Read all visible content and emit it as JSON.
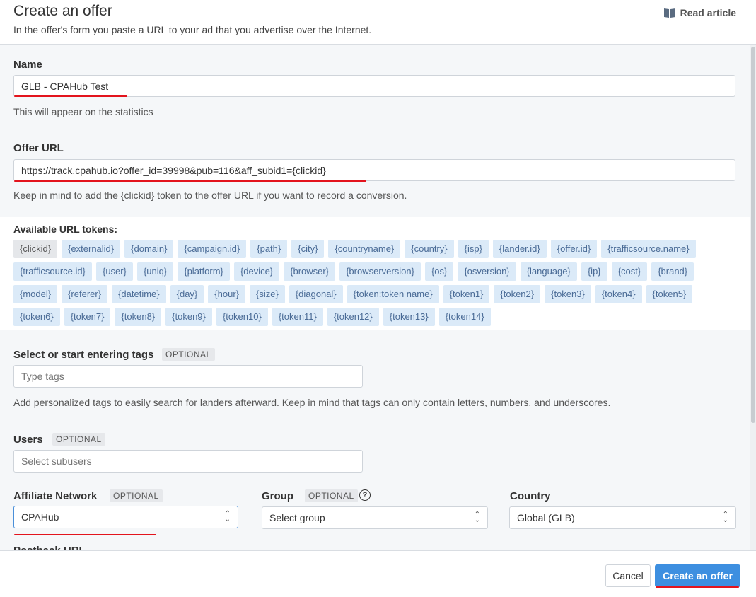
{
  "header": {
    "title": "Create an offer",
    "subtitle": "In the offer's form you paste a URL to your ad that you advertise over the Internet.",
    "read_article": "Read article"
  },
  "name": {
    "label": "Name",
    "value": "GLB - CPAHub Test",
    "help": "This will appear on the statistics"
  },
  "offer_url": {
    "label": "Offer URL",
    "value": "https://track.cpahub.io?offer_id=39998&pub=116&aff_subid1={clickid}",
    "help": "Keep in mind to add the {clickid} token to the offer URL if you want to record a conversion."
  },
  "tokens": {
    "label": "Available URL tokens:",
    "items": [
      "{clickid}",
      "{externalid}",
      "{domain}",
      "{campaign.id}",
      "{path}",
      "{city}",
      "{countryname}",
      "{country}",
      "{isp}",
      "{lander.id}",
      "{offer.id}",
      "{trafficsource.name}",
      "{trafficsource.id}",
      "{user}",
      "{uniq}",
      "{platform}",
      "{device}",
      "{browser}",
      "{browserversion}",
      "{os}",
      "{osversion}",
      "{language}",
      "{ip}",
      "{cost}",
      "{brand}",
      "{model}",
      "{referer}",
      "{datetime}",
      "{day}",
      "{hour}",
      "{size}",
      "{diagonal}",
      "{token:token name}",
      "{token1}",
      "{token2}",
      "{token3}",
      "{token4}",
      "{token5}",
      "{token6}",
      "{token7}",
      "{token8}",
      "{token9}",
      "{token10}",
      "{token11}",
      "{token12}",
      "{token13}",
      "{token14}"
    ]
  },
  "tags": {
    "label": "Select or start entering tags",
    "optional": "OPTIONAL",
    "placeholder": "Type tags",
    "help": "Add personalized tags to easily search for landers afterward. Keep in mind that tags can only contain letters, numbers, and underscores."
  },
  "users": {
    "label": "Users",
    "optional": "OPTIONAL",
    "placeholder": "Select subusers"
  },
  "affiliate_network": {
    "label": "Affiliate Network",
    "optional": "OPTIONAL",
    "value": "CPAHub"
  },
  "group": {
    "label": "Group",
    "optional": "OPTIONAL",
    "value": "Select group",
    "help_icon": "?"
  },
  "country": {
    "label": "Country",
    "value": "Global (GLB)"
  },
  "postback": {
    "label": "Postback URL"
  },
  "footer": {
    "cancel": "Cancel",
    "create": "Create an offer"
  },
  "colors": {
    "accent": "#3d8fe0",
    "annotation": "#e3141d",
    "token_bg": "#dbeaf8"
  }
}
